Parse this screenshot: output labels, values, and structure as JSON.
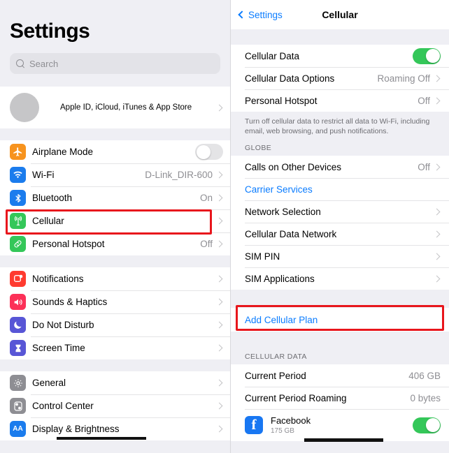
{
  "sidebar": {
    "title": "Settings",
    "search": {
      "placeholder": "Search",
      "icon": "search-icon"
    },
    "account": {
      "label": "Apple ID, iCloud, iTunes & App Store",
      "icon": "avatar"
    },
    "groups": [
      {
        "items": [
          {
            "label": "Airplane Mode",
            "icon": "airplane-icon",
            "icon_color": "#f7931e",
            "control": "toggle",
            "toggle_on": false
          },
          {
            "label": "Wi-Fi",
            "icon": "wifi-icon",
            "icon_color": "#1b7ced",
            "value": "D-Link_DIR-600",
            "control": "chevron"
          },
          {
            "label": "Bluetooth",
            "icon": "bluetooth-icon",
            "icon_color": "#1b7ced",
            "value": "On",
            "control": "chevron"
          },
          {
            "label": "Cellular",
            "icon": "cellular-antenna-icon",
            "icon_color": "#34c759",
            "value": "",
            "control": "chevron",
            "highlighted": true
          },
          {
            "label": "Personal Hotspot",
            "icon": "personal-hotspot-icon",
            "icon_color": "#34c759",
            "value": "Off",
            "control": "chevron"
          }
        ]
      },
      {
        "items": [
          {
            "label": "Notifications",
            "icon": "notifications-icon",
            "icon_color": "#ff3b30",
            "value": "",
            "control": "chevron"
          },
          {
            "label": "Sounds & Haptics",
            "icon": "sounds-haptics-icon",
            "icon_color": "#fc3158",
            "value": "",
            "control": "chevron"
          },
          {
            "label": "Do Not Disturb",
            "icon": "do-not-disturb-moon-icon",
            "icon_color": "#5856d6",
            "value": "",
            "control": "chevron"
          },
          {
            "label": "Screen Time",
            "icon": "screen-time-hourglass-icon",
            "icon_color": "#5856d6",
            "value": "",
            "control": "chevron"
          }
        ]
      },
      {
        "items": [
          {
            "label": "General",
            "icon": "gear-icon",
            "icon_color": "#8e8e93",
            "value": "",
            "control": "chevron"
          },
          {
            "label": "Control Center",
            "icon": "control-center-sliders-icon",
            "icon_color": "#8e8e93",
            "value": "",
            "control": "chevron"
          },
          {
            "label": "Display & Brightness",
            "icon": "display-brightness-aa-icon",
            "icon_color": "#1b7ced",
            "value": "",
            "control": "chevron",
            "redacted": true
          }
        ]
      }
    ]
  },
  "detail": {
    "back_label": "Settings",
    "title": "Cellular",
    "rows_top": [
      {
        "label": "Cellular Data",
        "control": "toggle",
        "toggle_on": true
      },
      {
        "label": "Cellular Data Options",
        "value": "Roaming Off",
        "control": "chevron"
      },
      {
        "label": "Personal Hotspot",
        "value": "Off",
        "control": "chevron"
      }
    ],
    "footnote": "Turn off cellular data to restrict all data to Wi-Fi, including email, web browsing, and push notifications.",
    "globe_header": "GLOBE",
    "rows_globe": [
      {
        "label": "Calls on Other Devices",
        "value": "Off",
        "control": "chevron"
      },
      {
        "label": "Carrier Services",
        "value": "",
        "control": "none",
        "link": true
      },
      {
        "label": "Network Selection",
        "value": "",
        "control": "chevron"
      },
      {
        "label": "Cellular Data Network",
        "value": "",
        "control": "chevron"
      },
      {
        "label": "SIM PIN",
        "value": "",
        "control": "chevron"
      },
      {
        "label": "SIM Applications",
        "value": "",
        "control": "chevron"
      }
    ],
    "add_plan": {
      "label": "Add Cellular Plan",
      "link": true,
      "highlighted": true
    },
    "cellular_data_header": "CELLULAR DATA",
    "usage_rows": [
      {
        "label": "Current Period",
        "value": "406 GB"
      },
      {
        "label": "Current Period Roaming",
        "value": "0 bytes"
      }
    ],
    "app_row": {
      "name": "Facebook",
      "usage": "175 GB",
      "icon": "facebook-icon",
      "toggle_on": true,
      "redacted": true
    }
  },
  "colors": {
    "accent_blue": "#0a7cff",
    "toggle_on_green": "#34c759",
    "highlight_red": "#e8161c",
    "panel_gray": "#efeff4"
  }
}
